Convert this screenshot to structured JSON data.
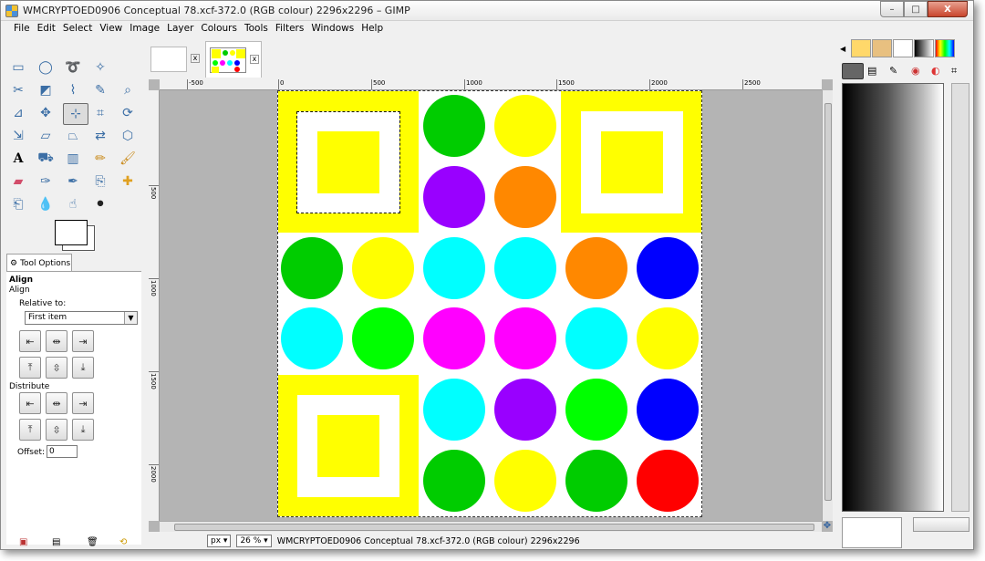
{
  "window": {
    "title": "WMCRYPTOED0906 Conceptual 78.xcf-372.0 (RGB colour) 2296x2296 – GIMP",
    "controls": {
      "minimize": "–",
      "maximize": "□",
      "close": "X"
    }
  },
  "menubar": {
    "items": [
      "File",
      "Edit",
      "Select",
      "View",
      "Image",
      "Layer",
      "Colours",
      "Tools",
      "Filters",
      "Windows",
      "Help"
    ]
  },
  "toolbox": {
    "tools": [
      "rect-select-icon",
      "ellipse-select-icon",
      "free-select-icon",
      "fuzzy-select-icon",
      "",
      "scissors-icon",
      "foreground-select-icon",
      "paths-icon",
      "color-picker-icon",
      "zoom-icon",
      "measure-icon",
      "move-icon",
      "align-icon",
      "crop-icon",
      "rotate-icon",
      "scale-icon",
      "shear-icon",
      "perspective-icon",
      "flip-icon",
      "cage-icon",
      "text-icon",
      "bucket-fill-icon",
      "blend-icon",
      "pencil-icon",
      "paintbrush-icon",
      "eraser-icon",
      "airbrush-icon",
      "ink-icon",
      "clone-icon",
      "heal-icon",
      "perspective-clone-icon",
      "blur-icon",
      "smudge-icon",
      "dodge-burn-icon",
      ""
    ],
    "active_tool": "align-icon"
  },
  "tool_options": {
    "tab_label": "Tool Options",
    "heading": "Align",
    "subheading": "Align",
    "relative_to_label": "Relative to:",
    "relative_to_value": "First item",
    "distribute_label": "Distribute",
    "offset_label": "Offset:",
    "offset_value": "0"
  },
  "image_tabs": [
    "blank-image-tab",
    "circles-image-tab"
  ],
  "rulers": {
    "horizontal": [
      "-500",
      "0",
      "500",
      "1000",
      "1500",
      "2000",
      "2500"
    ],
    "vertical": [
      "500",
      "1000",
      "1500",
      "2000"
    ]
  },
  "canvas_colors": {
    "yellow": "#ffff00",
    "green": "#00cc00",
    "lime": "#00ff00",
    "purple": "#9900ff",
    "orange": "#ff8800",
    "cyan": "#00ffff",
    "blue": "#0000ff",
    "magenta": "#ff00ff",
    "red": "#ff0000"
  },
  "statusbar": {
    "unit": "px",
    "zoom": "26 %",
    "message": "WMCRYPTOED0906 Conceptual 78.xcf-372.0 (RGB colour) 2296x2296"
  }
}
